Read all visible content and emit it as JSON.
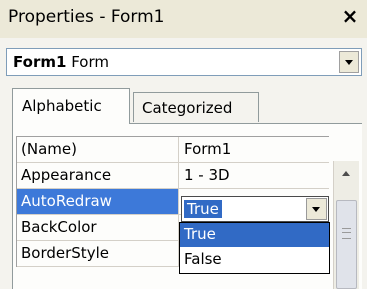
{
  "window": {
    "title": "Properties - Form1",
    "close_label": "×"
  },
  "object_selector": {
    "name": "Form1",
    "type": "Form"
  },
  "tabs": [
    {
      "label": "Alphabetic",
      "active": true
    },
    {
      "label": "Categorized",
      "active": false
    }
  ],
  "properties": [
    {
      "name": "(Name)",
      "value": "Form1"
    },
    {
      "name": "Appearance",
      "value": "1 - 3D"
    },
    {
      "name": "AutoRedraw",
      "value": "True",
      "selected": true
    },
    {
      "name": "BackColor",
      "value": ""
    },
    {
      "name": "BorderStyle",
      "value": ""
    }
  ],
  "editor": {
    "value": "True"
  },
  "dropdown": {
    "options": [
      "True",
      "False"
    ],
    "highlighted": "True"
  },
  "colors": {
    "selection": "#316ac5",
    "panel": "#ece9d8"
  }
}
